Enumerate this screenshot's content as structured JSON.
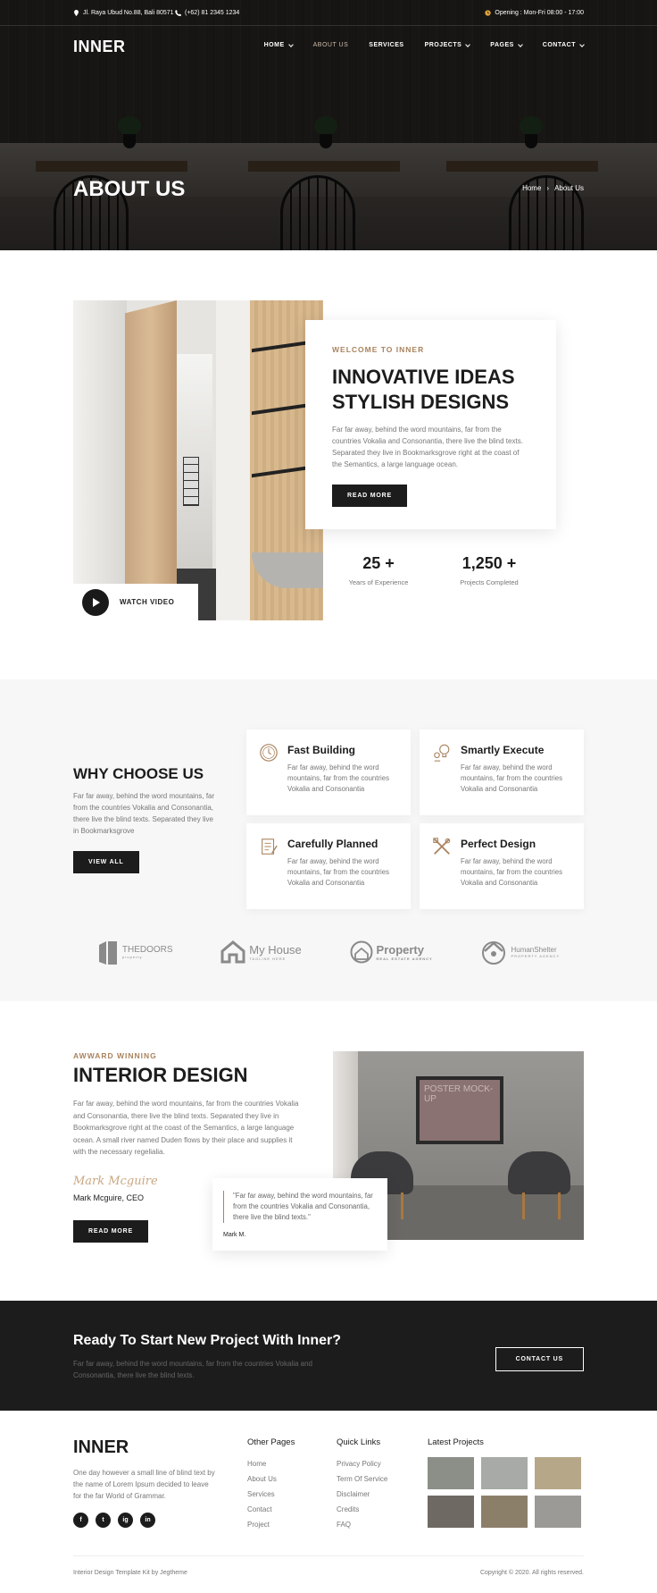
{
  "topbar": {
    "address": "Jl. Raya Ubud No.88, Bali 80571",
    "phone": "(+62) 81 2345 1234",
    "hours": "Opening : Mon-Fri 08:00 - 17:00"
  },
  "nav": {
    "logo": "INNER",
    "items": [
      {
        "label": "HOME"
      },
      {
        "label": "ABOUT US"
      },
      {
        "label": "SERVICES"
      },
      {
        "label": "PROJECTS"
      },
      {
        "label": "PAGES"
      },
      {
        "label": "CONTACT"
      }
    ]
  },
  "hero": {
    "title": "ABOUT US",
    "breadcrumb": {
      "home": "Home",
      "sep": "›",
      "current": "About Us"
    }
  },
  "about": {
    "watch_label": "WATCH VIDEO",
    "kicker": "WELCOME TO INNER",
    "heading_1": "INNOVATIVE IDEAS",
    "heading_2": "STYLISH DESIGNS",
    "body": "Far far away, behind the word mountains, far from the countries Vokalia and Consonantia, there live the blind texts. Separated they live in Bookmarksgrove right at the coast of the Semantics, a large language ocean.",
    "button": "READ MORE",
    "stats": [
      {
        "value": "25 +",
        "label": "Years of Experience"
      },
      {
        "value": "1,250 +",
        "label": "Projects Completed"
      }
    ]
  },
  "why": {
    "heading": "WHY CHOOSE US",
    "body": "Far far away, behind the word mountains, far from the countries Vokalia and Consonantia, there live the blind texts. Separated they live in Bookmarksgrove",
    "button": "VIEW ALL",
    "features": [
      {
        "title": "Fast Building",
        "text": "Far far away, behind the word mountains, far from the countries Vokalia and Consonantia",
        "icon": "clock-icon"
      },
      {
        "title": "Smartly Execute",
        "text": "Far far away, behind the word mountains, far from the countries Vokalia and Consonantia",
        "icon": "idea-icon"
      },
      {
        "title": "Carefully Planned",
        "text": "Far far away, behind the word mountains, far from the countries Vokalia and Consonantia",
        "icon": "plan-icon"
      },
      {
        "title": "Perfect Design",
        "text": "Far far away, behind the word mountains, far from the countries Vokalia and Consonantia",
        "icon": "tools-icon"
      }
    ],
    "logos": [
      {
        "name": "THEDOORS",
        "tagline": "property"
      },
      {
        "name": "My House",
        "tagline": "TAGLINE HERE"
      },
      {
        "name": "Property",
        "tagline": "REAL ESTATE AGENCY"
      },
      {
        "name": "HumanShelter",
        "tagline": "PROPERTY AGENCY"
      }
    ]
  },
  "interior": {
    "kicker": "AWWARD WINNING",
    "heading": "INTERIOR DESIGN",
    "body": "Far far away, behind the word mountains, far from the countries Vokalia and Consonantia, there live the blind texts. Separated they live in Bookmarksgrove right at the coast of the Semantics, a large language ocean. A small river named Duden flows by their place and supplies it with the necessary regelialia.",
    "signature": "Mark Mcguire",
    "ceo": "Mark Mcguire, CEO",
    "button": "READ MORE",
    "poster_text": "POSTER MOCK-UP",
    "quote": "\"Far far away, behind the word mountains, far from the countries Vokalia and Consonantia, there live the blind texts.\"",
    "quote_author": "Mark M."
  },
  "cta": {
    "heading": "Ready To Start New Project With Inner?",
    "body": "Far far away, behind the word mountains, far from the countries Vokalia and Consonantia, there live the blind texts.",
    "button": "CONTACT US"
  },
  "footer": {
    "logo": "INNER",
    "desc": "One day however a small line of blind text by the name of Lorem Ipsum decided to leave for the far World of Grammar.",
    "social": [
      "f",
      "t",
      "ig",
      "in"
    ],
    "col1": {
      "title": "Other Pages",
      "links": [
        "Home",
        "About Us",
        "Services",
        "Contact",
        "Project"
      ]
    },
    "col2": {
      "title": "Quick Links",
      "links": [
        "Privacy Policy",
        "Term Of Service",
        "Disclaimer",
        "Credits",
        "FAQ"
      ]
    },
    "col3": {
      "title": "Latest Projects"
    },
    "thumb_colors": [
      "#8b8f88",
      "#a7aaa6",
      "#b7a789",
      "#6e6a63",
      "#8c7f6a",
      "#9c9a96"
    ],
    "left_note": "Interior Design Template Kit by Jegtheme",
    "copyright": "Copyright © 2020. All rights reserved."
  }
}
